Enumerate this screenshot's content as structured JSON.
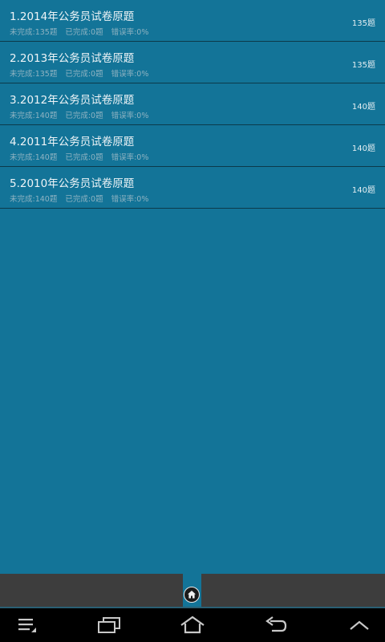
{
  "exam_list": [
    {
      "title": "1.2014年公务员试卷原题",
      "incomplete": "未完成:135题",
      "completed": "已完成:0题",
      "error_rate": "错误率:0%",
      "count": "135题"
    },
    {
      "title": "2.2013年公务员试卷原题",
      "incomplete": "未完成:135题",
      "completed": "已完成:0题",
      "error_rate": "错误率:0%",
      "count": "135题"
    },
    {
      "title": "3.2012年公务员试卷原题",
      "incomplete": "未完成:140题",
      "completed": "已完成:0题",
      "error_rate": "错误率:0%",
      "count": "140题"
    },
    {
      "title": "4.2011年公务员试卷原题",
      "incomplete": "未完成:140题",
      "completed": "已完成:0题",
      "error_rate": "错误率:0%",
      "count": "140题"
    },
    {
      "title": "5.2010年公务员试卷原题",
      "incomplete": "未完成:140题",
      "completed": "已完成:0题",
      "error_rate": "错误率:0%",
      "count": "140题"
    }
  ],
  "icons": {
    "home": "home-icon",
    "menu": "menu-icon",
    "recent_apps": "recent-apps-icon",
    "nav_home": "nav-home-icon",
    "back": "back-icon",
    "up": "chevron-up-icon"
  },
  "colors": {
    "background": "#137498",
    "bottom_bar": "#3d3d3d",
    "nav_bar": "#000000"
  }
}
